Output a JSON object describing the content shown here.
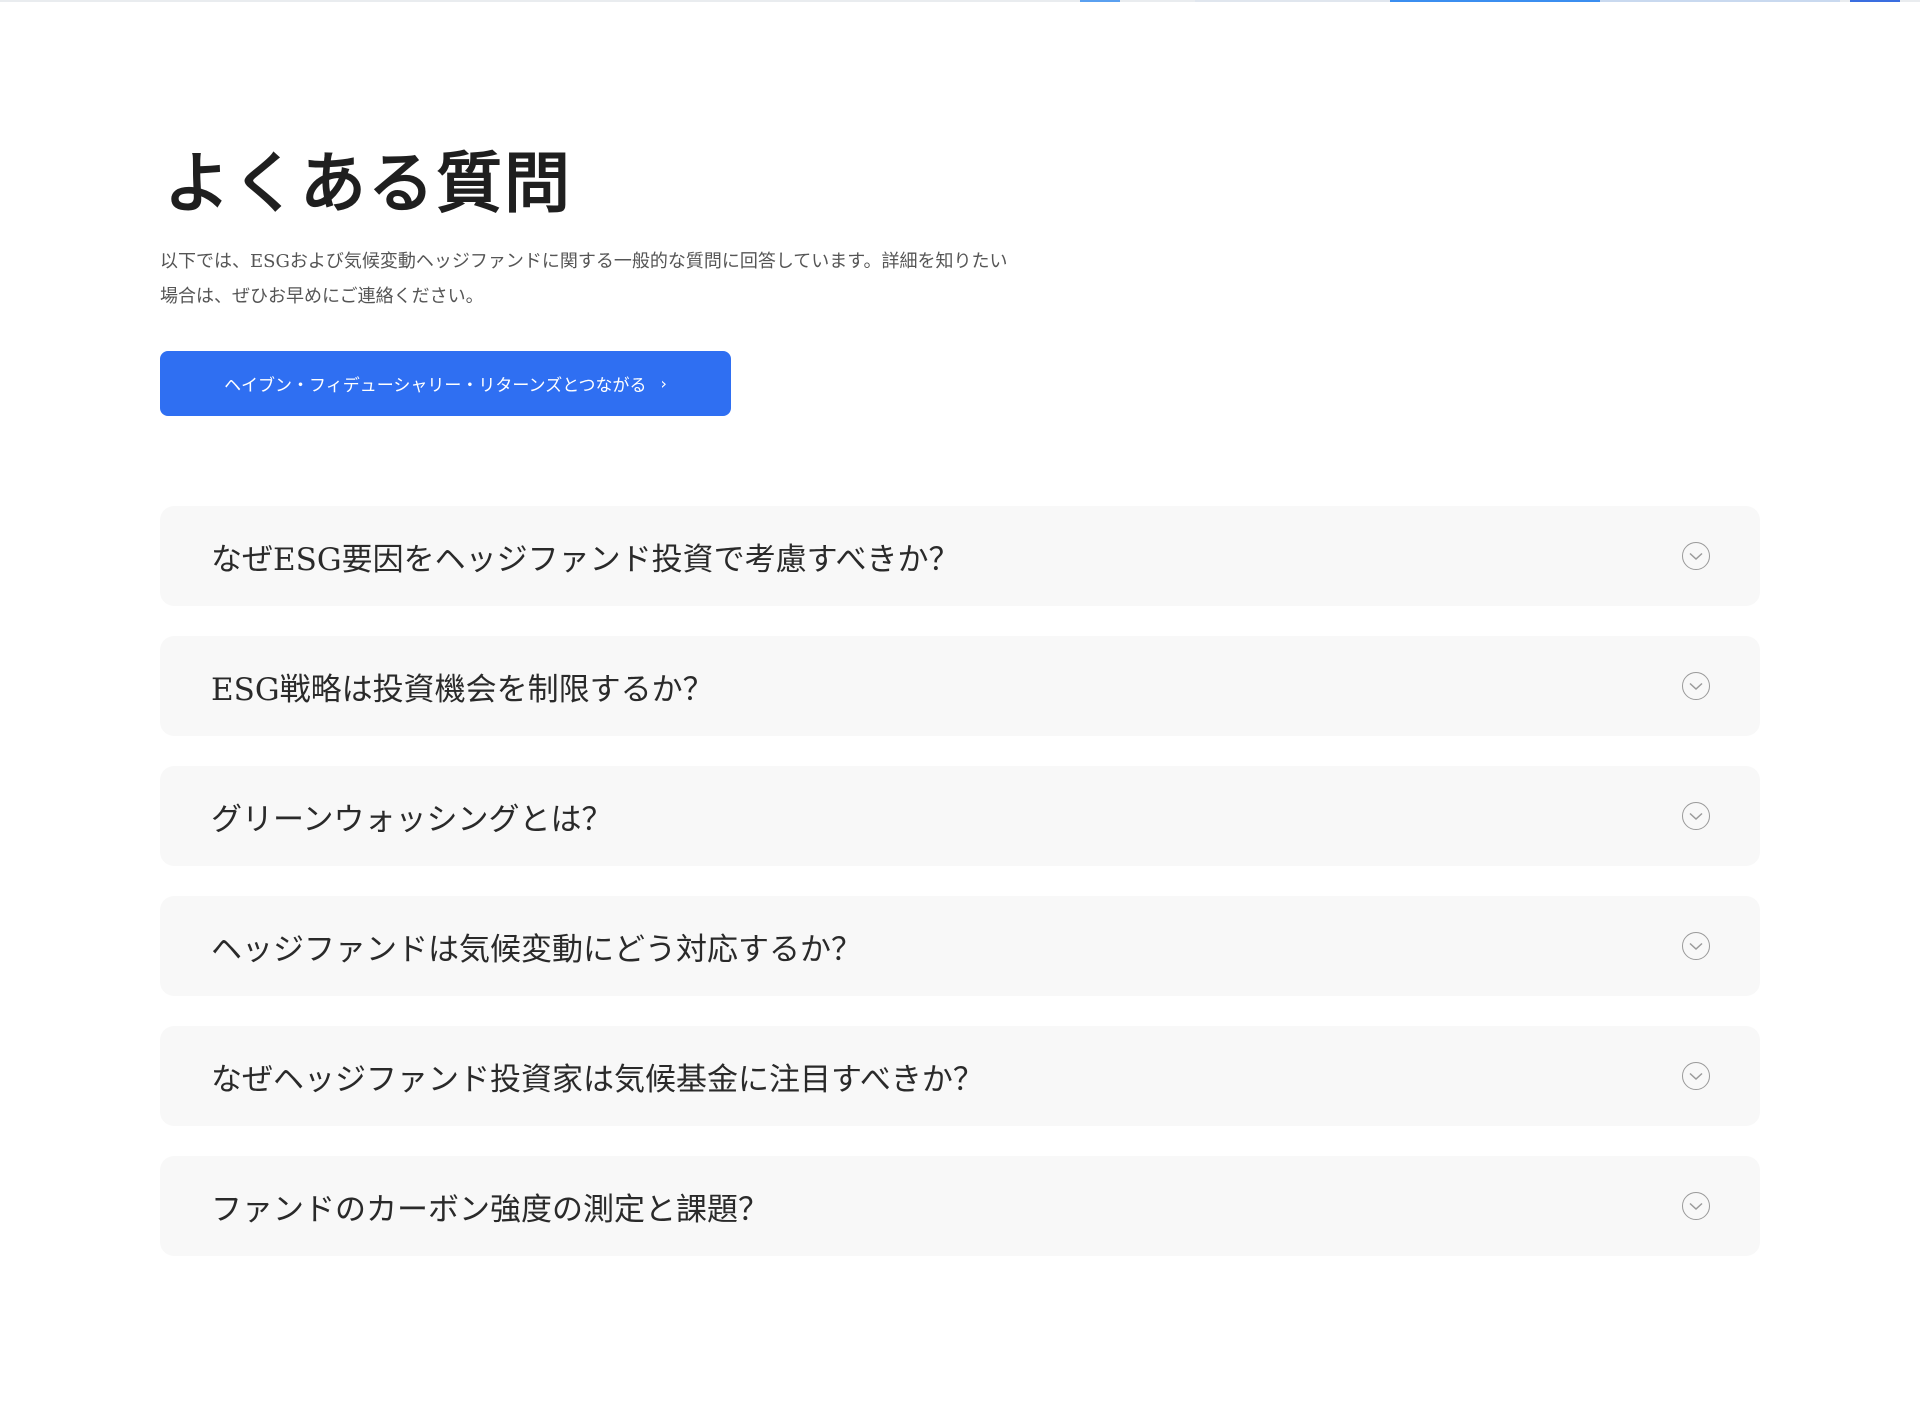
{
  "faq": {
    "title": "よくある質問",
    "intro": "以下では、ESGおよび気候変動ヘッジファンドに関する一般的な質問に回答しています。詳細を知りたい場合は、ぜひお早めにご連絡ください。",
    "cta_label": "ヘイブン・フィデューシャリー・リターンズとつながる",
    "cta_icon": "chevron-right-icon",
    "item_icon": "chevron-down-circle-icon",
    "items": [
      {
        "question": "なぜESG要因をヘッジファンド投資で考慮すべきか？"
      },
      {
        "question": "ESG戦略は投資機会を制限するか？"
      },
      {
        "question": "グリーンウォッシングとは？"
      },
      {
        "question": "ヘッジファンドは気候変動にどう対応するか？"
      },
      {
        "question": "なぜヘッジファンド投資家は気候基金に注目すべきか？"
      },
      {
        "question": "ファンドのカーボン強度の測定と課題？"
      }
    ]
  },
  "colors": {
    "accent": "#2f6ff2",
    "card_background": "#f8f8f8",
    "text": "#222222",
    "muted_text": "#555555"
  }
}
